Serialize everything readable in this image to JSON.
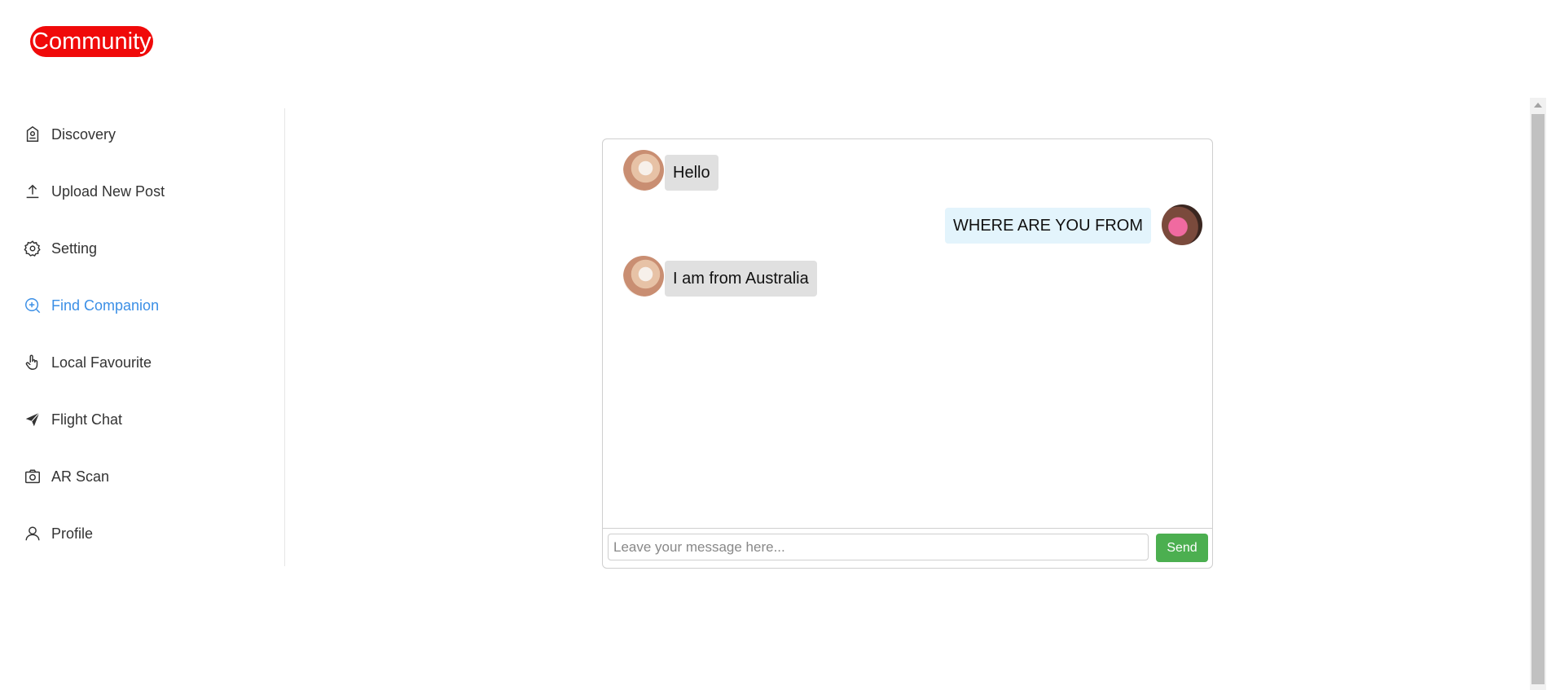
{
  "app": {
    "logo": "Community"
  },
  "sidebar": {
    "items": [
      {
        "label": "Discovery",
        "icon": "discovery-icon",
        "active": false
      },
      {
        "label": "Upload New Post",
        "icon": "upload-icon",
        "active": false
      },
      {
        "label": "Setting",
        "icon": "gear-icon",
        "active": false
      },
      {
        "label": "Find Companion",
        "icon": "search-plus-icon",
        "active": true
      },
      {
        "label": "Local Favourite",
        "icon": "hand-pointer-icon",
        "active": false
      },
      {
        "label": "Flight Chat",
        "icon": "paper-plane-icon",
        "active": false
      },
      {
        "label": "AR Scan",
        "icon": "camera-icon",
        "active": false
      },
      {
        "label": "Profile",
        "icon": "user-icon",
        "active": false
      }
    ],
    "active_color": "#3b8fe6"
  },
  "chat": {
    "messages": [
      {
        "sender": "other",
        "text": "Hello"
      },
      {
        "sender": "me",
        "text": "WHERE ARE YOU FROM"
      },
      {
        "sender": "other",
        "text": "I am from Australia"
      }
    ],
    "input": {
      "placeholder": "Leave your message here...",
      "value": ""
    },
    "send_label": "Send",
    "send_color": "#4caf50"
  },
  "colors": {
    "logo_bg": "#f00a0a",
    "other_bubble": "#e0e0e0",
    "my_bubble": "#e3f4fc"
  }
}
